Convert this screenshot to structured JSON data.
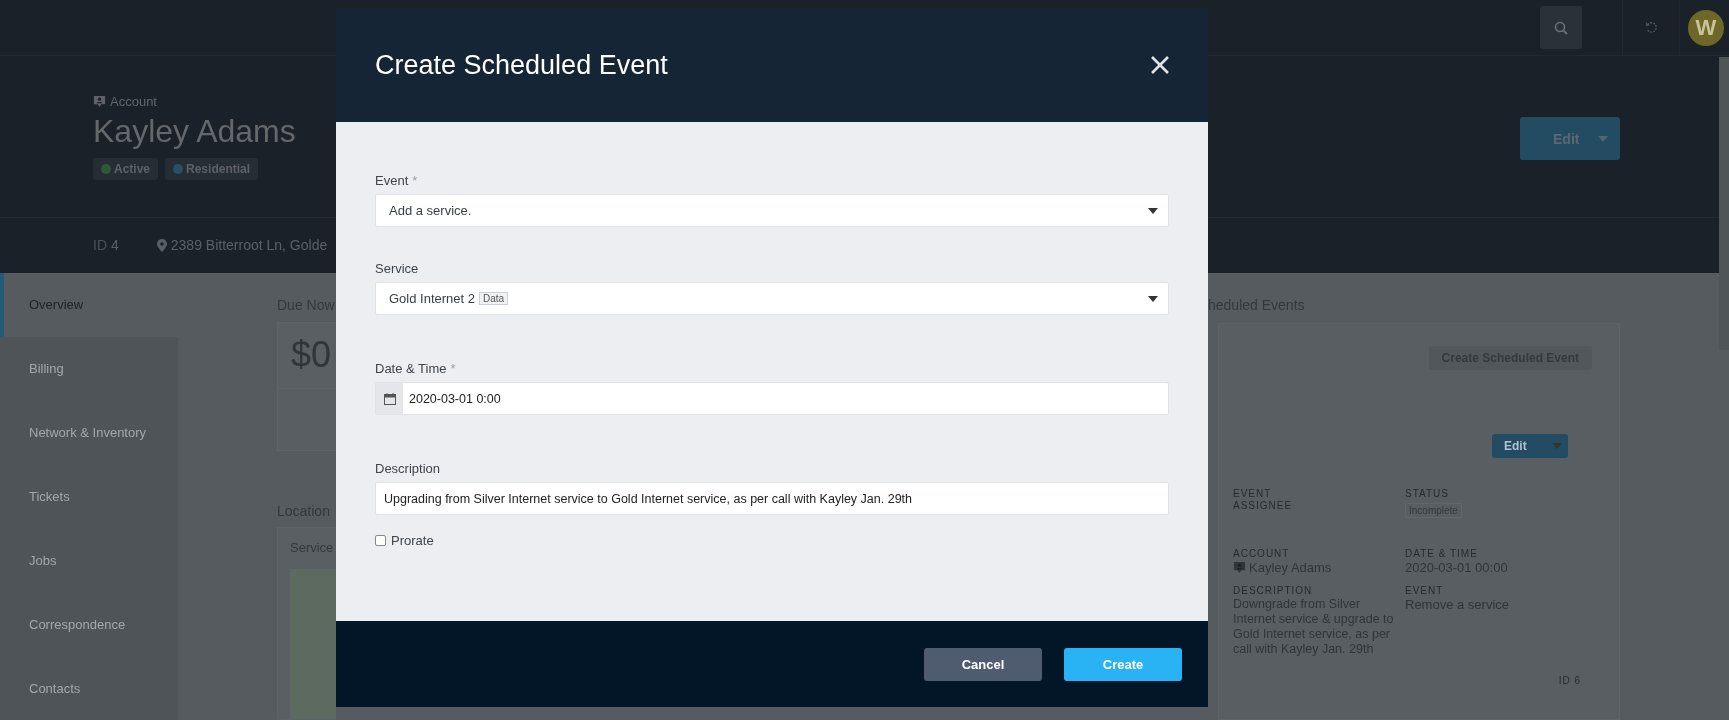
{
  "top_bar": {
    "avatar_letter": "W"
  },
  "account": {
    "type_label": "Account",
    "name": "Kayley Adams",
    "badges": [
      {
        "label": "Active",
        "color": "#2c5a38"
      },
      {
        "label": "Residential",
        "color": "#28506a"
      }
    ],
    "id_label": "ID",
    "id_value": "4",
    "address": "2389 Bitterroot Ln, Golde",
    "edit_button": "Edit"
  },
  "sidebar": {
    "items": [
      {
        "label": "Overview",
        "selected": true
      },
      {
        "label": "Billing",
        "selected": false
      },
      {
        "label": "Network & Inventory",
        "selected": false
      },
      {
        "label": "Tickets",
        "selected": false
      },
      {
        "label": "Jobs",
        "selected": false
      },
      {
        "label": "Correspondence",
        "selected": false
      },
      {
        "label": "Contacts",
        "selected": false
      }
    ]
  },
  "due_now": {
    "title": "Due Now",
    "amount": "$0"
  },
  "location": {
    "title": "Location",
    "card_title": "Service"
  },
  "scheduled_events": {
    "title": "heduled Events",
    "create_button": "Create Scheduled Event",
    "edit_button": "Edit",
    "assignee_label": "EVENT ASSIGNEE",
    "status_label": "STATUS",
    "status": "Incomplete",
    "account_label": "ACCOUNT",
    "account": "Kayley Adams",
    "datetime_label": "DATE & TIME",
    "datetime": "2020-03-01 00:00",
    "description_label": "DESCRIPTION",
    "description": "Downgrade from Silver Internet service & upgrade to Gold Internet service, as per call with Kayley Jan. 29th",
    "event_label": "EVENT",
    "event": "Remove a service",
    "id": "ID 6"
  },
  "modal": {
    "title": "Create Scheduled Event",
    "fields": [
      {
        "kind": "select",
        "label": "Event",
        "required_mark": "*",
        "value": "Add a service."
      },
      {
        "kind": "select",
        "label": "Service",
        "value": "Gold Internet 2",
        "tag": "Data"
      },
      {
        "kind": "date",
        "label": "Date & Time",
        "required_mark": "*",
        "value": "2020-03-01 0:00"
      },
      {
        "kind": "text",
        "label": "Description",
        "value": "Upgrading from Silver Internet service to Gold Internet service, as per call with Kayley Jan. 29th"
      }
    ],
    "prorate": {
      "label": "Prorate",
      "checked": false
    },
    "buttons": [
      {
        "label": "Cancel",
        "kind": "secondary"
      },
      {
        "label": "Create",
        "kind": "primary"
      }
    ]
  }
}
